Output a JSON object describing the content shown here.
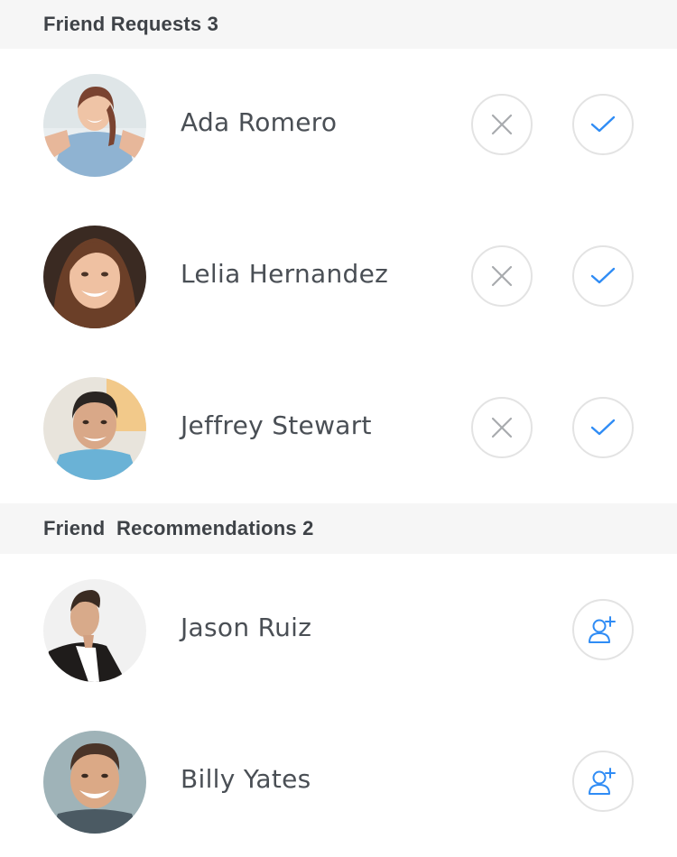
{
  "friend_requests": {
    "header": "Friend Requests 3",
    "items": [
      {
        "name": "Ada Romero"
      },
      {
        "name": "Lelia Hernandez"
      },
      {
        "name": "Jeffrey Stewart"
      }
    ]
  },
  "friend_recommendations": {
    "header": "Friend  Recommendations 2",
    "items": [
      {
        "name": "Jason Ruiz"
      },
      {
        "name": "Billy Yates"
      }
    ]
  },
  "colors": {
    "accent": "#2f8cf5",
    "decline_icon": "#a8abae",
    "button_border": "#e3e3e3",
    "header_bg": "#f6f6f6"
  },
  "icons": {
    "decline": "close-icon",
    "accept": "check-icon",
    "add_friend": "add-user-icon"
  }
}
